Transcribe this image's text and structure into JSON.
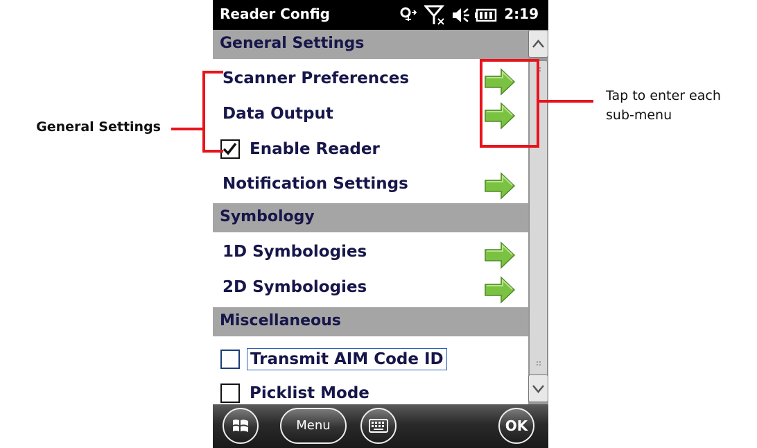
{
  "annotations": {
    "left_label": "General Settings",
    "right_label_line1": "Tap to enter each",
    "right_label_line2": "sub-menu"
  },
  "status_bar": {
    "title": "Reader Config",
    "time": "2:19",
    "icons": [
      "sync-icon",
      "no-signal-icon",
      "volume-icon",
      "battery-icon"
    ]
  },
  "sections": {
    "general_settings": {
      "header": "General Settings",
      "scanner_preferences": "Scanner Preferences",
      "data_output": "Data Output",
      "enable_reader": "Enable Reader",
      "enable_reader_checked": true,
      "notification_settings": "Notification Settings"
    },
    "symbology": {
      "header": "Symbology",
      "symbologies_1d": "1D Symbologies",
      "symbologies_2d": "2D Symbologies"
    },
    "miscellaneous": {
      "header": "Miscellaneous",
      "transmit_aim": "Transmit AIM Code ID",
      "transmit_aim_checked": false,
      "picklist_mode": "Picklist Mode",
      "picklist_mode_checked": false
    }
  },
  "bottom_bar": {
    "menu_label": "Menu",
    "ok_label": "OK",
    "icons": [
      "windows-start-icon",
      "keyboard-icon"
    ]
  },
  "colors": {
    "header_bg": "#a5a5a5",
    "item_text": "#16164a",
    "arrow_green": "#7cc242",
    "annotation_red": "#e8141c"
  }
}
